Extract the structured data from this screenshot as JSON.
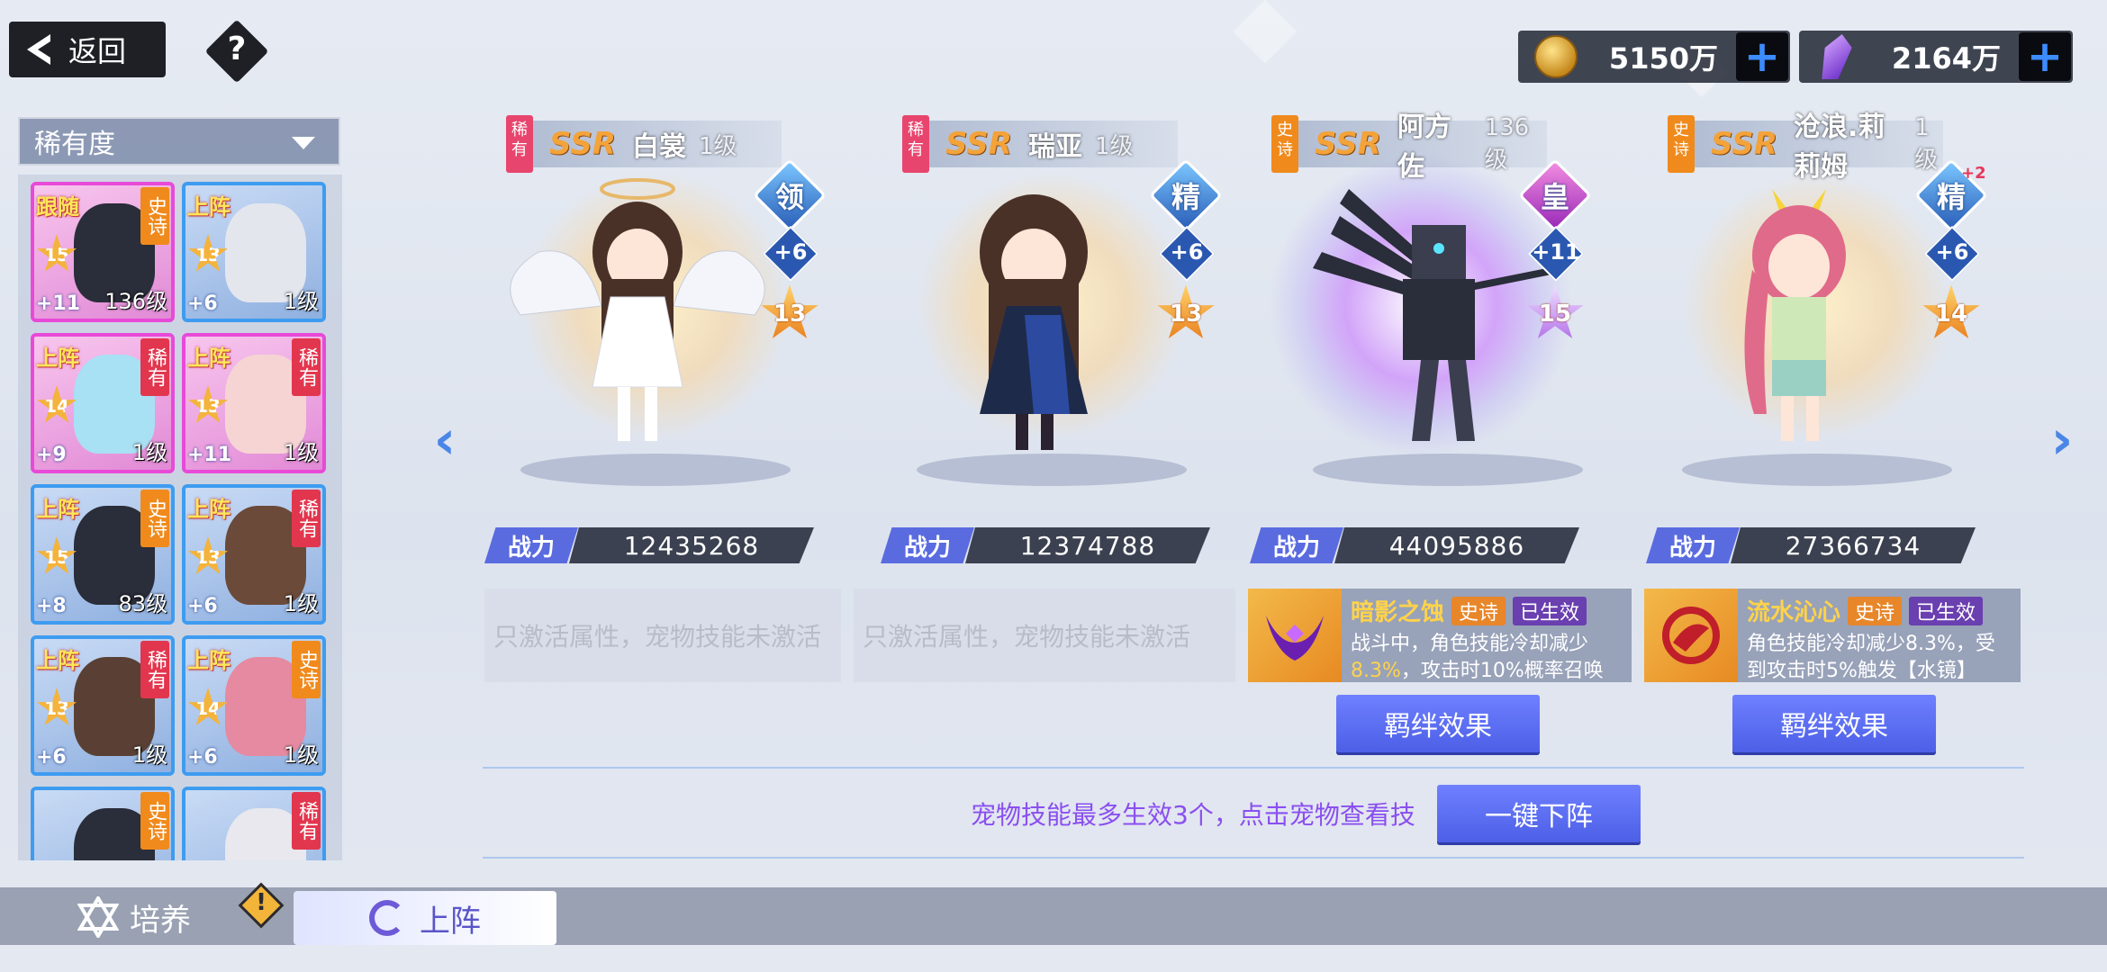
{
  "topbar": {
    "back_label": "返回",
    "help_label": "?",
    "gold": {
      "value": "5150万",
      "plus": "+"
    },
    "crystal": {
      "value": "2164万",
      "plus": "+"
    }
  },
  "sort": {
    "label": "稀有度"
  },
  "roster": [
    {
      "deploy": "跟随",
      "tag": "史诗",
      "star": "15",
      "plus": "+11",
      "level": "136级"
    },
    {
      "deploy": "上阵",
      "tag": "",
      "star": "13",
      "plus": "+6",
      "level": "1级"
    },
    {
      "deploy": "上阵",
      "tag": "稀有",
      "star": "14",
      "plus": "+9",
      "level": "1级"
    },
    {
      "deploy": "上阵",
      "tag": "稀有",
      "star": "13",
      "plus": "+11",
      "level": "1级"
    },
    {
      "deploy": "上阵",
      "tag": "史诗",
      "star": "15",
      "plus": "+8",
      "level": "83级"
    },
    {
      "deploy": "上阵",
      "tag": "稀有",
      "star": "13",
      "plus": "+6",
      "level": "1级"
    },
    {
      "deploy": "上阵",
      "tag": "稀有",
      "star": "13",
      "plus": "+6",
      "level": "1级"
    },
    {
      "deploy": "上阵",
      "tag": "史诗",
      "star": "14",
      "plus": "+6",
      "level": "1级"
    },
    {
      "deploy": "",
      "tag": "史诗",
      "star": "",
      "plus": "",
      "level": ""
    },
    {
      "deploy": "",
      "tag": "稀有",
      "star": "",
      "plus": "",
      "level": ""
    }
  ],
  "heroes": [
    {
      "rarity": "稀有",
      "grade": "SSR",
      "name": "白裳",
      "level": "1级",
      "rank": "领",
      "plus": "+6",
      "star": "13",
      "power_label": "战力",
      "power": "12435268",
      "pet_inactive": "只激活属性，宠物技能未激活"
    },
    {
      "rarity": "稀有",
      "grade": "SSR",
      "name": "瑞亚",
      "level": "1级",
      "rank": "精",
      "plus": "+6",
      "star": "13",
      "power_label": "战力",
      "power": "12374788",
      "pet_inactive": "只激活属性，宠物技能未激活"
    },
    {
      "rarity": "史诗",
      "grade": "SSR",
      "name": "阿方佐",
      "level": "136级",
      "rank": "皇",
      "plus": "+11",
      "star": "15",
      "power_label": "战力",
      "power": "44095886",
      "pet": {
        "name": "暗影之蚀",
        "quality": "史诗",
        "status": "已生效",
        "desc_a": "战斗中，角色技能冷却减少",
        "desc_hl": "8.3%",
        "desc_b": "，攻击时10%概率召唤"
      },
      "bond_label": "羁绊效果"
    },
    {
      "rarity": "史诗",
      "grade": "SSR",
      "name": "沧浪.莉莉姆",
      "level": "1级",
      "rank": "精",
      "rank_sup": "+2",
      "plus": "+6",
      "star": "14",
      "power_label": "战力",
      "power": "27366734",
      "pet": {
        "name": "流水沁心",
        "quality": "史诗",
        "status": "已生效",
        "desc_a": "角色技能冷却减少8.3%，受",
        "desc_b": "到攻击时5%触发【水镜】"
      },
      "bond_label": "羁绊效果"
    }
  ],
  "tip": "宠物技能最多生效3个，点击宠物查看技",
  "undeploy_label": "一键下阵",
  "tabs": {
    "cultivate": "培养",
    "warn": "!",
    "deploy": "上阵"
  },
  "nav": {
    "prev": "‹",
    "next": "›"
  },
  "colors": {
    "accent": "#5a6be0",
    "ssr": "#f3a33a",
    "tip": "#8a4ff0"
  }
}
